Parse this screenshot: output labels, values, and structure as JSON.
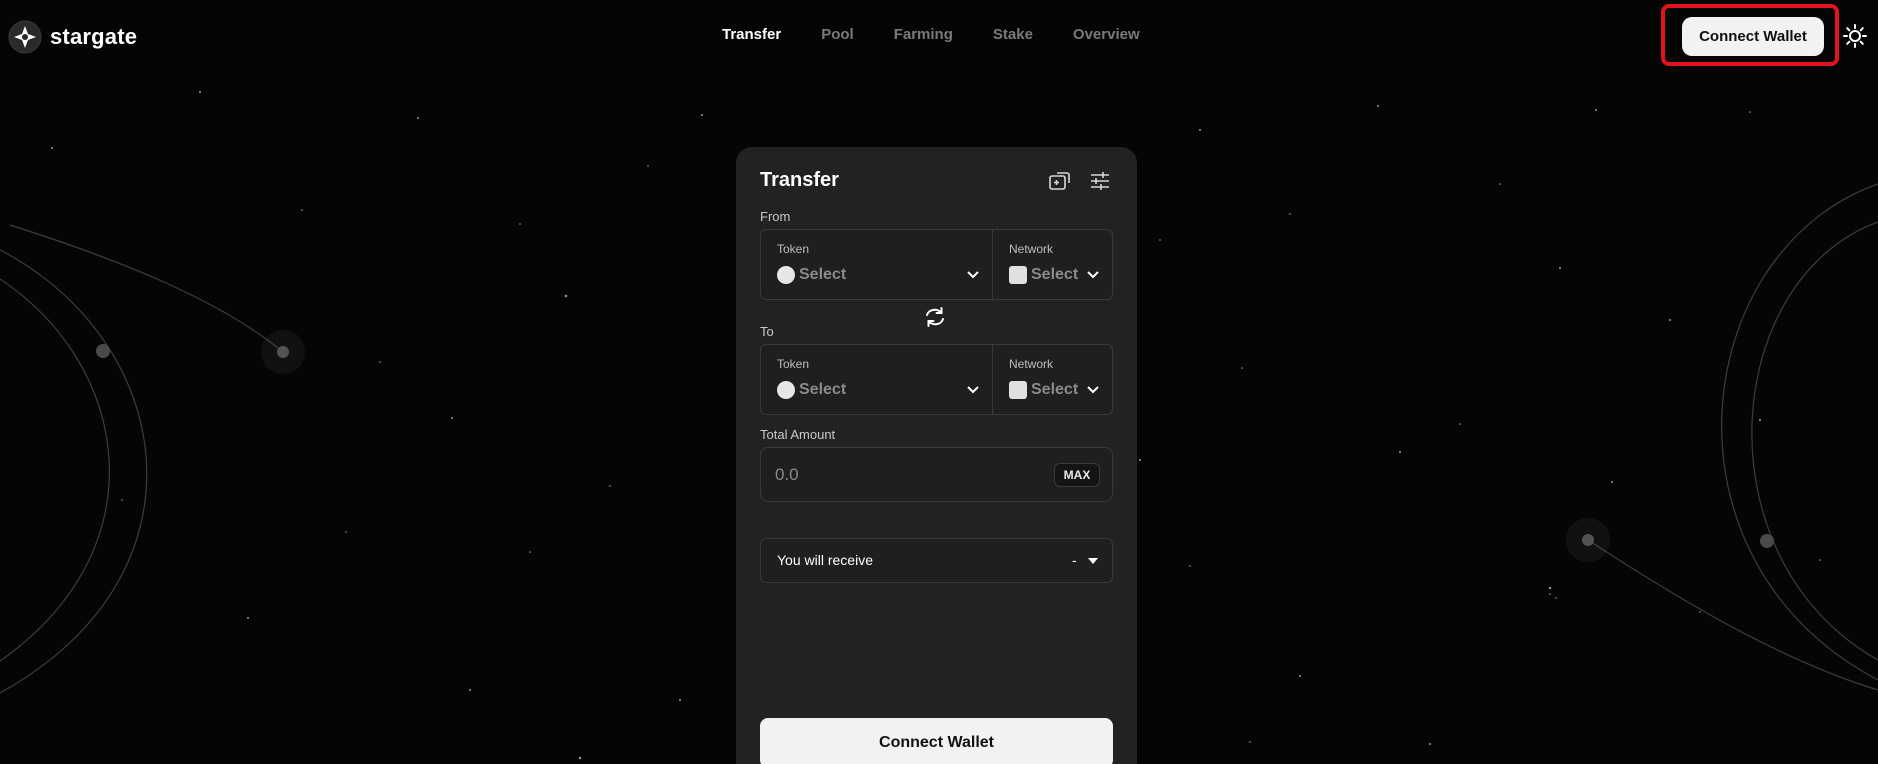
{
  "brand": {
    "name": "stargate"
  },
  "nav": [
    {
      "label": "Transfer",
      "active": true
    },
    {
      "label": "Pool",
      "active": false
    },
    {
      "label": "Farming",
      "active": false
    },
    {
      "label": "Stake",
      "active": false
    },
    {
      "label": "Overview",
      "active": false
    }
  ],
  "header": {
    "connect_label": "Connect Wallet",
    "theme_icon": "sun-icon",
    "highlight_color": "#e0141e"
  },
  "transfer": {
    "title": "Transfer",
    "icons": [
      "bridge-icon",
      "settings-sliders-icon"
    ],
    "from": {
      "section_label": "From",
      "token_label": "Token",
      "token_value": "Select",
      "network_label": "Network",
      "network_value": "Select"
    },
    "swap_icon": "swap-arrows-icon",
    "to": {
      "section_label": "To",
      "token_label": "Token",
      "token_value": "Select",
      "network_label": "Network",
      "network_value": "Select"
    },
    "amount": {
      "label": "Total Amount",
      "placeholder": "0.0",
      "max_label": "MAX"
    },
    "receive": {
      "label": "You will receive",
      "value": "-"
    },
    "connect_label": "Connect Wallet"
  },
  "colors": {
    "background": "#050505",
    "card": "#222222",
    "button": "#f2f2f2"
  }
}
